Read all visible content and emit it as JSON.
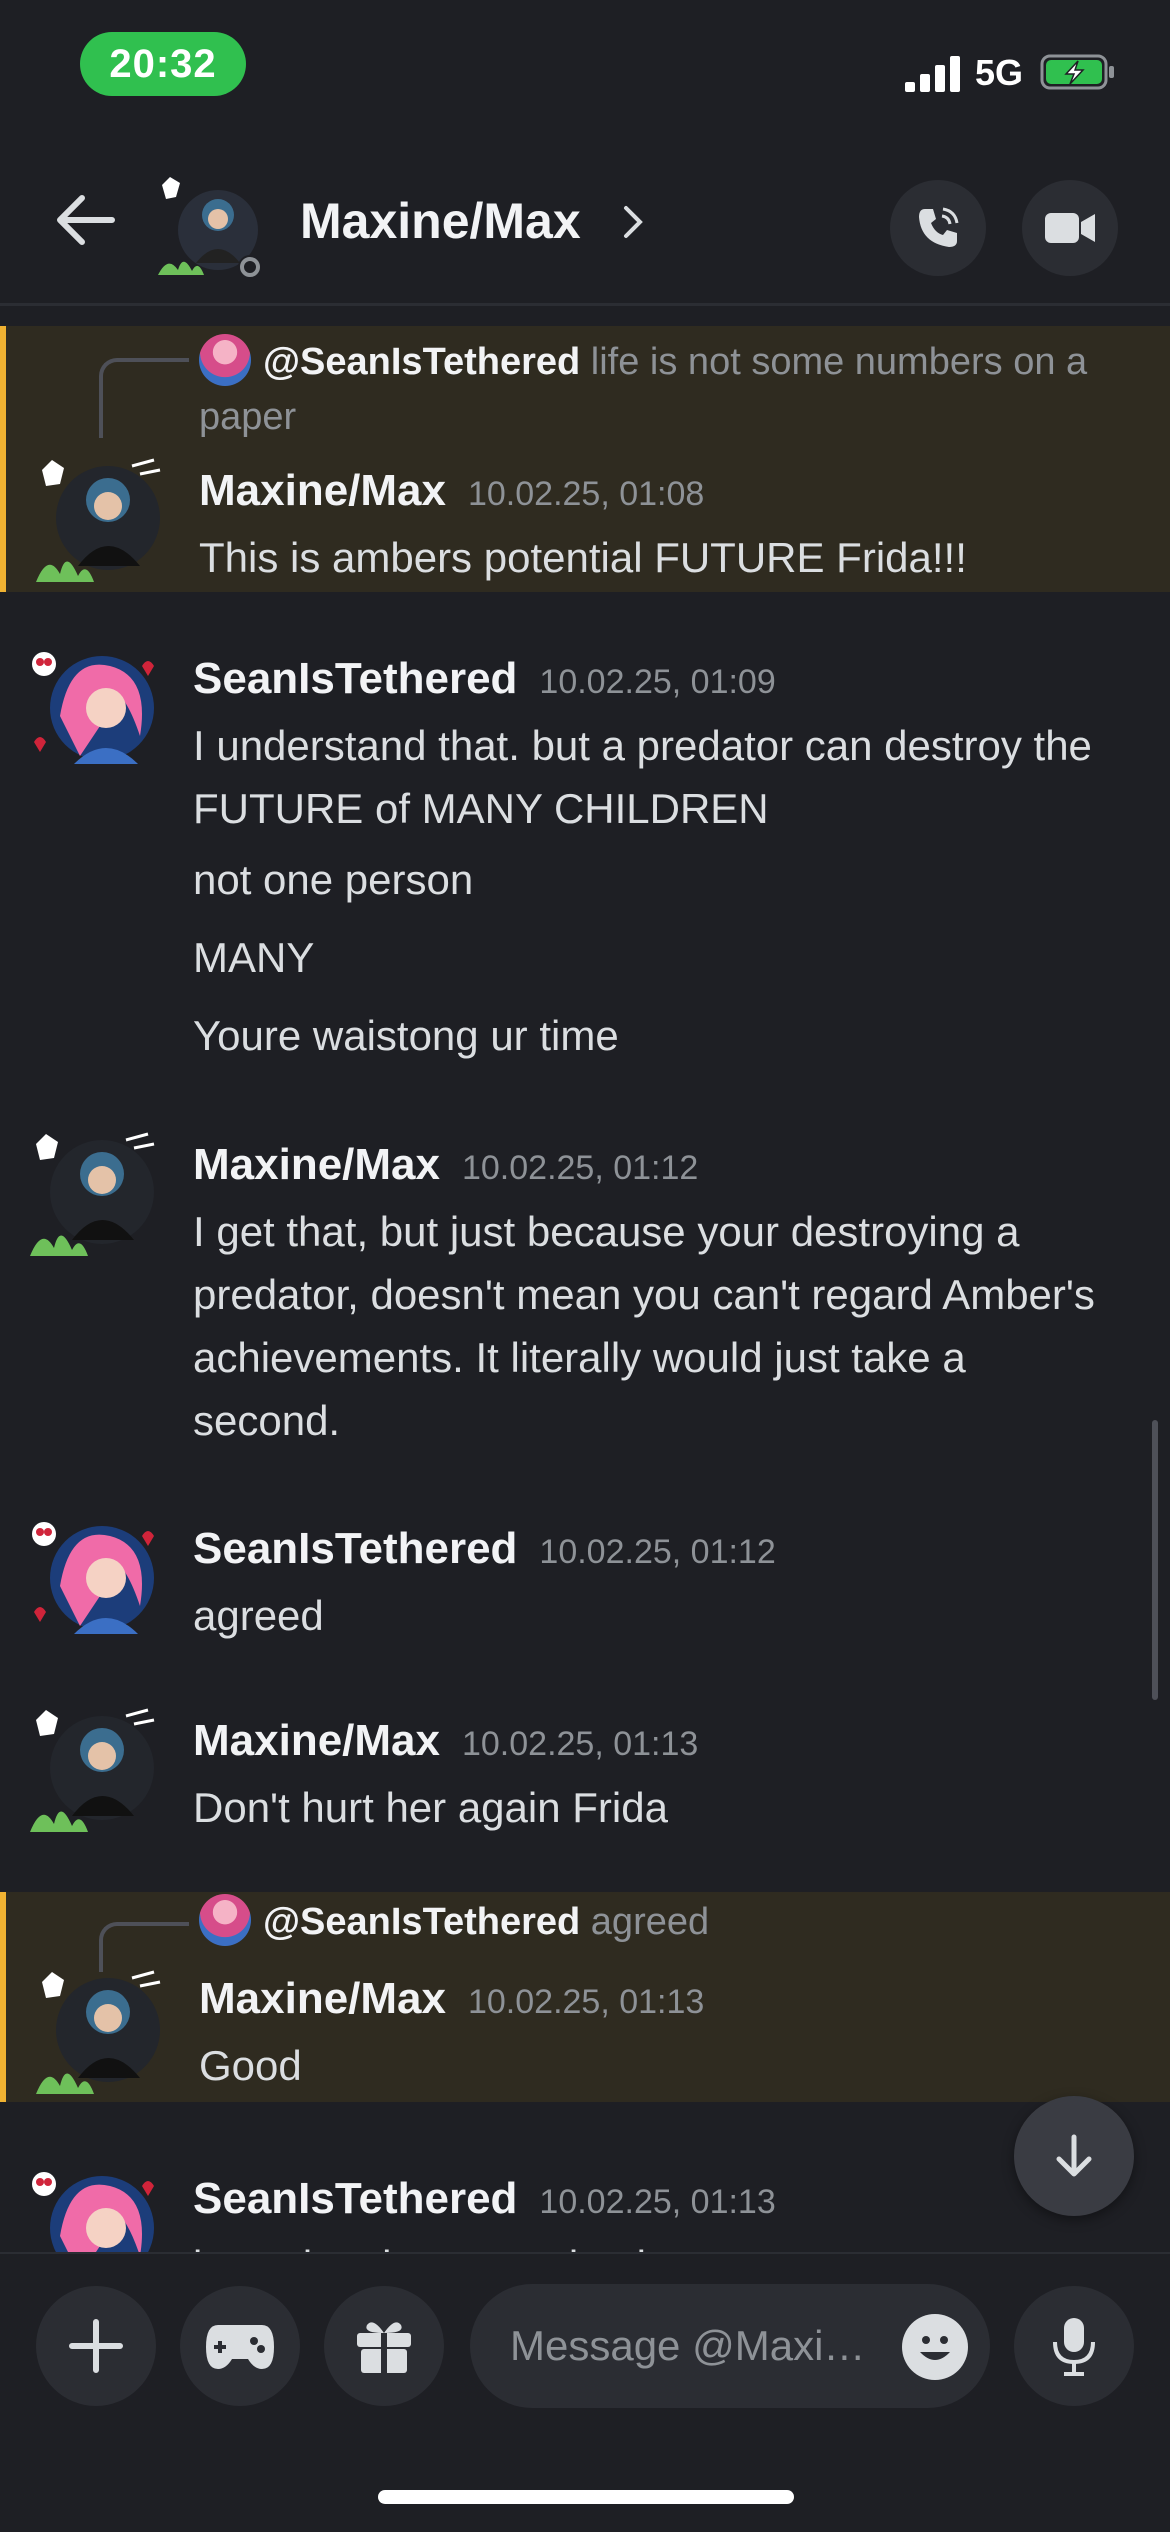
{
  "status_bar": {
    "time": "20:32",
    "network": "5G"
  },
  "header": {
    "title": "Maxine/Max"
  },
  "messages": [
    {
      "reply_to": {
        "user": "@SeanIsTethered",
        "text": "life is not some numbers on a paper"
      },
      "author": "Maxine/Max",
      "timestamp": "10.02.25, 01:08",
      "lines": [
        "This is ambers potential FUTURE Frida!!!"
      ]
    },
    {
      "author": "SeanIsTethered",
      "timestamp": "10.02.25, 01:09",
      "lines": [
        "I understand that. but a predator can destroy the FUTURE of MANY CHILDREN",
        "not one person",
        "MANY",
        "Youre waistong ur time"
      ]
    },
    {
      "author": "Maxine/Max",
      "timestamp": "10.02.25, 01:12",
      "lines": [
        "I get that, but just because your destroying a predator, doesn't mean you can't regard Amber's achievements.  It literally would just take a second."
      ]
    },
    {
      "author": "SeanIsTethered",
      "timestamp": "10.02.25, 01:12",
      "lines": [
        "agreed"
      ]
    },
    {
      "author": "Maxine/Max",
      "timestamp": "10.02.25, 01:13",
      "lines": [
        "Don't hurt her again Frida"
      ]
    },
    {
      "reply_to": {
        "user": "@SeanIsTethered",
        "text": "agreed"
      },
      "author": "Maxine/Max",
      "timestamp": "10.02.25, 01:13",
      "lines": [
        "Good"
      ]
    },
    {
      "author": "SeanIsTethered",
      "timestamp": "10.02.25, 01:13",
      "lines": [
        "issue has been resolved"
      ]
    }
  ],
  "composer": {
    "placeholder": "Message @Maxi…"
  },
  "colors": {
    "highlight_bg": "#2f2b20",
    "highlight_border": "#f0b232",
    "time_pill": "#30c04f",
    "background": "#1e1f24"
  },
  "icons": [
    "back-arrow-icon",
    "chevron-right-icon",
    "phone-icon",
    "video-camera-icon",
    "arrow-down-icon",
    "plus-icon",
    "gamepad-icon",
    "gift-icon",
    "emoji-icon",
    "microphone-icon"
  ]
}
